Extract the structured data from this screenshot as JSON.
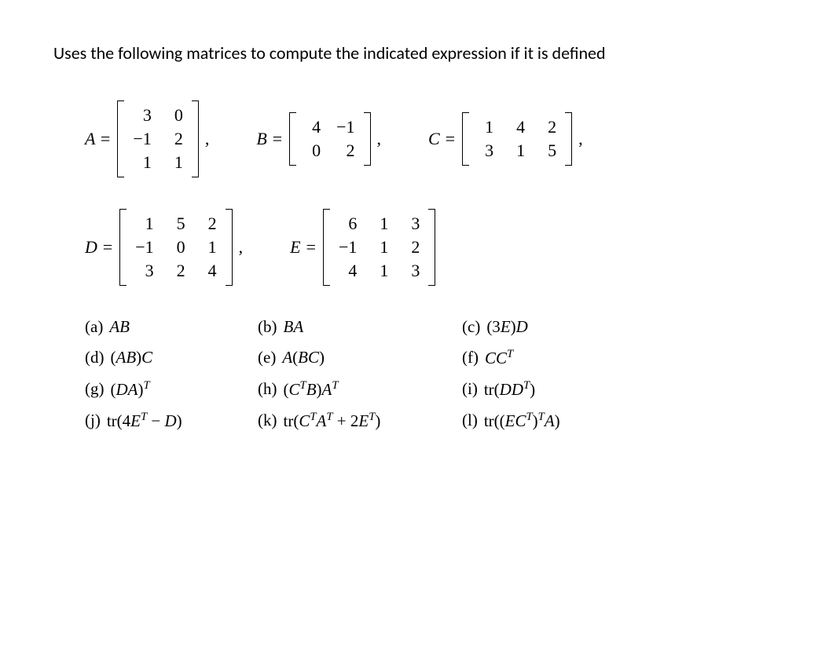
{
  "intro": "Uses the following matrices to compute the indicated expression if it is defined",
  "matrices": {
    "A": {
      "label": "A =",
      "rows": [
        [
          "3",
          "0"
        ],
        [
          "−1",
          "2"
        ],
        [
          "1",
          "1"
        ]
      ],
      "tail": ","
    },
    "B": {
      "label": "B =",
      "rows": [
        [
          "4",
          "−1"
        ],
        [
          "0",
          "2"
        ]
      ],
      "tail": ","
    },
    "C": {
      "label": "C =",
      "rows": [
        [
          "1",
          "4",
          "2"
        ],
        [
          "3",
          "1",
          "5"
        ]
      ],
      "tail": ","
    },
    "D": {
      "label": "D =",
      "rows": [
        [
          "1",
          "5",
          "2"
        ],
        [
          "−1",
          "0",
          "1"
        ],
        [
          "3",
          "2",
          "4"
        ]
      ],
      "tail": ","
    },
    "E": {
      "label": "E =",
      "rows": [
        [
          "6",
          "1",
          "3"
        ],
        [
          "−1",
          "1",
          "2"
        ],
        [
          "4",
          "1",
          "3"
        ]
      ],
      "tail": ""
    }
  },
  "problems": {
    "a": {
      "label": "(a)",
      "expr": "AB"
    },
    "b": {
      "label": "(b)",
      "expr": "BA"
    },
    "c": {
      "label": "(c)",
      "expr": "(3E)D"
    },
    "d": {
      "label": "(d)",
      "expr": "(AB)C"
    },
    "e": {
      "label": "(e)",
      "expr": "A(BC)"
    },
    "f": {
      "label": "(f)",
      "expr_html": "<i>CC</i><sup><i>T</i></sup>"
    },
    "g": {
      "label": "(g)",
      "expr_html": "(<i>DA</i>)<sup><i>T</i></sup>"
    },
    "h": {
      "label": "(h)",
      "expr_html": "(<i>C</i><sup><i>T</i></sup><i>B</i>)<i>A</i><sup><i>T</i></sup>"
    },
    "i": {
      "label": "(i)",
      "expr_html": "tr(<i>DD</i><sup><i>T</i></sup>)"
    },
    "j": {
      "label": "(j)",
      "expr_html": "tr(4<i>E</i><sup><i>T</i></sup> − <i>D</i>)"
    },
    "k": {
      "label": "(k)",
      "expr_html": "tr(<i>C</i><sup><i>T</i></sup><i>A</i><sup><i>T</i></sup> + 2<i>E</i><sup><i>T</i></sup>)"
    },
    "l": {
      "label": "(l)",
      "expr_html": "tr((<i>EC</i><sup><i>T</i></sup>)<sup><i>T</i></sup><i>A</i>)"
    }
  }
}
